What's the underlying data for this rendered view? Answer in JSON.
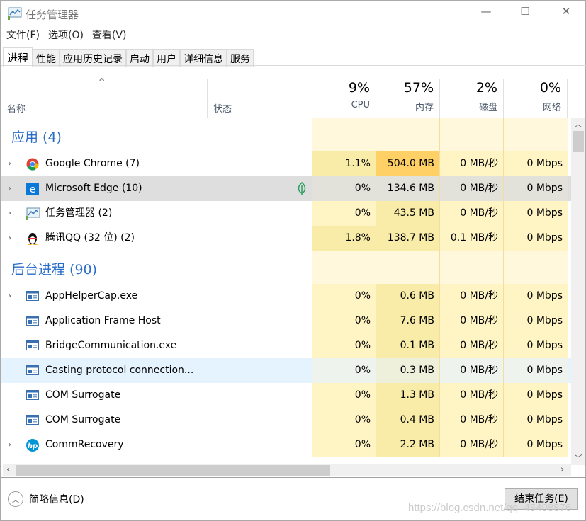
{
  "window": {
    "title": "任务管理器",
    "minimize": "—",
    "maximize": "☐",
    "close": "✕"
  },
  "menu": [
    "文件(F)",
    "选项(O)",
    "查看(V)"
  ],
  "tabs": [
    "进程",
    "性能",
    "应用历史记录",
    "启动",
    "用户",
    "详细信息",
    "服务"
  ],
  "active_tab": "进程",
  "columns": {
    "name": "名称",
    "status": "状态",
    "cpu": {
      "pct": "9%",
      "label": "CPU"
    },
    "memory": {
      "pct": "57%",
      "label": "内存"
    },
    "disk": {
      "pct": "2%",
      "label": "磁盘"
    },
    "network": {
      "pct": "0%",
      "label": "网络"
    }
  },
  "groups": [
    {
      "title": "应用 (4)",
      "rows": [
        {
          "name": "Google Chrome (7)",
          "icon": "chrome-icon",
          "expand": true,
          "cpu": "1.1%",
          "mem": "504.0 MB",
          "disk": "0 MB/秒",
          "net": "0 Mbps",
          "state": "normal",
          "highmem": true
        },
        {
          "name": "Microsoft Edge (10)",
          "icon": "edge-icon",
          "expand": true,
          "status_icon": "leaf-icon",
          "cpu": "0%",
          "mem": "134.6 MB",
          "disk": "0 MB/秒",
          "net": "0 Mbps",
          "state": "selected"
        },
        {
          "name": "任务管理器 (2)",
          "icon": "task-manager-icon",
          "expand": true,
          "cpu": "0%",
          "mem": "43.5 MB",
          "disk": "0 MB/秒",
          "net": "0 Mbps",
          "state": "normal"
        },
        {
          "name": "腾讯QQ (32 位) (2)",
          "icon": "qq-penguin-icon",
          "expand": true,
          "cpu": "1.8%",
          "mem": "138.7 MB",
          "disk": "0.1 MB/秒",
          "net": "0 Mbps",
          "state": "normal",
          "hicpu": true
        }
      ]
    },
    {
      "title": "后台进程 (90)",
      "rows": [
        {
          "name": "AppHelperCap.exe",
          "icon": "window-icon",
          "expand": true,
          "cpu": "0%",
          "mem": "0.6 MB",
          "disk": "0 MB/秒",
          "net": "0 Mbps",
          "state": "normal"
        },
        {
          "name": "Application Frame Host",
          "icon": "window-icon",
          "expand": false,
          "cpu": "0%",
          "mem": "7.6 MB",
          "disk": "0 MB/秒",
          "net": "0 Mbps",
          "state": "normal"
        },
        {
          "name": "BridgeCommunication.exe",
          "icon": "window-icon",
          "expand": false,
          "cpu": "0%",
          "mem": "0.1 MB",
          "disk": "0 MB/秒",
          "net": "0 Mbps",
          "state": "normal"
        },
        {
          "name": "Casting protocol connection...",
          "icon": "window-icon",
          "expand": false,
          "cpu": "0%",
          "mem": "0.3 MB",
          "disk": "0 MB/秒",
          "net": "0 Mbps",
          "state": "hover"
        },
        {
          "name": "COM Surrogate",
          "icon": "window-icon",
          "expand": false,
          "cpu": "0%",
          "mem": "1.3 MB",
          "disk": "0 MB/秒",
          "net": "0 Mbps",
          "state": "normal"
        },
        {
          "name": "COM Surrogate",
          "icon": "window-icon",
          "expand": false,
          "cpu": "0%",
          "mem": "0.4 MB",
          "disk": "0 MB/秒",
          "net": "0 Mbps",
          "state": "normal"
        },
        {
          "name": "CommRecovery",
          "icon": "hp-icon",
          "expand": true,
          "cpu": "0%",
          "mem": "2.2 MB",
          "disk": "0 MB/秒",
          "net": "0 Mbps",
          "state": "normal"
        }
      ]
    }
  ],
  "footer": {
    "fewer_details": "简略信息(D)",
    "end_task": "结束任务(E)"
  },
  "watermark": "https://blog.csdn.net/qq_45408876",
  "colors": {
    "group_title": "#2a6dc9",
    "heat_light": "#fff4c4",
    "heat_mid": "#f9eca8",
    "heat_high": "#ffd066",
    "selected": "#dedede",
    "hover": "#e5f3ff"
  }
}
